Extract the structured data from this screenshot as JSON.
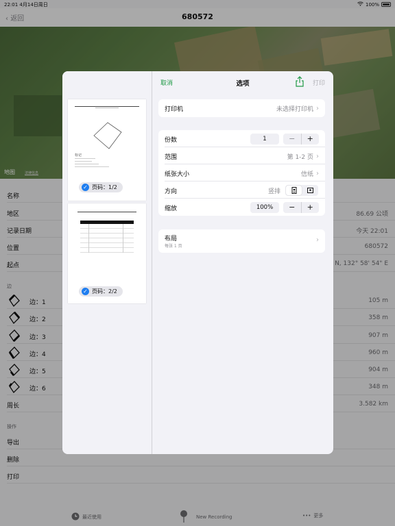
{
  "status_bar": {
    "time": "22:01",
    "date": "4月14日周日",
    "battery": "100%"
  },
  "nav": {
    "back_label": "返回",
    "title": "680572"
  },
  "map": {
    "logo": "地图",
    "legal": "法律信息"
  },
  "details": {
    "rows": [
      {
        "label": "名称",
        "value": ""
      },
      {
        "label": "地区",
        "value": "86.69 公顷"
      },
      {
        "label": "记录日期",
        "value": "今天 22:01"
      },
      {
        "label": "位置",
        "value": "680572"
      },
      {
        "label": "起点",
        "value": "° N, 132° 58' 54\" E"
      }
    ]
  },
  "edges": {
    "section_title": "边",
    "items": [
      {
        "label": "边：1",
        "value": "105 m"
      },
      {
        "label": "边：2",
        "value": "358 m"
      },
      {
        "label": "边：3",
        "value": "907 m"
      },
      {
        "label": "边：4",
        "value": "960 m"
      },
      {
        "label": "边：5",
        "value": "904 m"
      },
      {
        "label": "边：6",
        "value": "348 m"
      }
    ],
    "perimeter_label": "周长",
    "perimeter_value": "3.582 km"
  },
  "actions": {
    "section_title": "操作",
    "items": [
      "导出",
      "删除",
      "打印"
    ]
  },
  "toolbar": {
    "recent": "最近使用",
    "record": "New Recording",
    "more": "更多"
  },
  "print_dialog": {
    "cancel": "取消",
    "title": "选项",
    "print": "打印",
    "pages": [
      {
        "badge": "页码：1/2"
      },
      {
        "badge": "页码：2/2"
      }
    ],
    "preview_page1_label": "标记",
    "printer_label": "打印机",
    "printer_value": "未选择打印机",
    "copies_label": "份数",
    "copies_value": "1",
    "range_label": "范围",
    "range_value": "第 1-2 页",
    "paper_label": "纸张大小",
    "paper_value": "信纸",
    "orientation_label": "方向",
    "orientation_value": "竖排",
    "scale_label": "缩放",
    "scale_value": "100%",
    "layout_label": "布局",
    "layout_sub": "每张 1 页"
  },
  "colors": {
    "accent_green": "#1f9a46",
    "check_blue": "#1f7ef0"
  }
}
